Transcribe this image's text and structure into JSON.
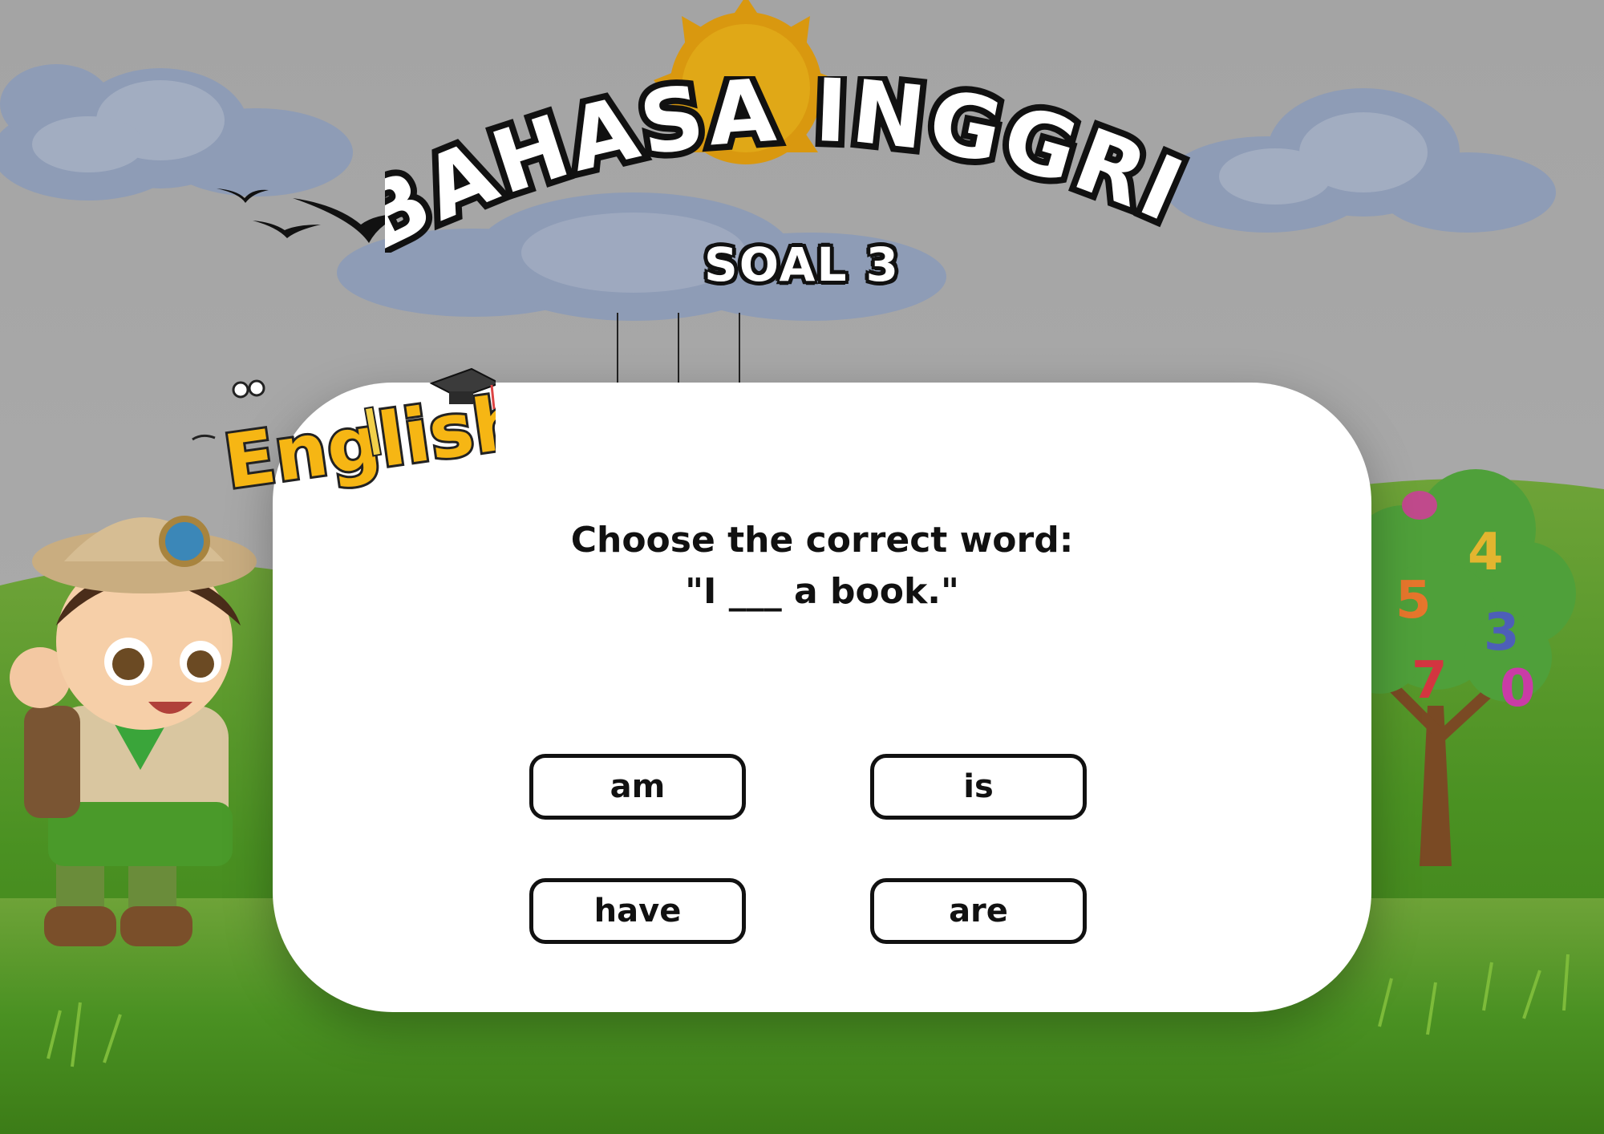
{
  "header": {
    "title": "BAHASA INGGRIS",
    "subtitle": "SOAL 3"
  },
  "logo": {
    "text": "English"
  },
  "question": {
    "line1": "Choose the correct word:",
    "line2": "\"I ___ a book.\""
  },
  "options": [
    {
      "label": "am"
    },
    {
      "label": "is"
    },
    {
      "label": "have"
    },
    {
      "label": "are"
    }
  ],
  "colors": {
    "sky": "#a6a6a6",
    "grass": "#3f8a1f",
    "card": "#ffffff",
    "outline": "#111111",
    "logo_yellow": "#f6b614",
    "sun": "#d9980f"
  },
  "icons": [
    "sun-icon",
    "bird-icon",
    "graduation-cap-icon",
    "pencil-icon",
    "explorer-boy-illustration",
    "number-tree-illustration"
  ]
}
